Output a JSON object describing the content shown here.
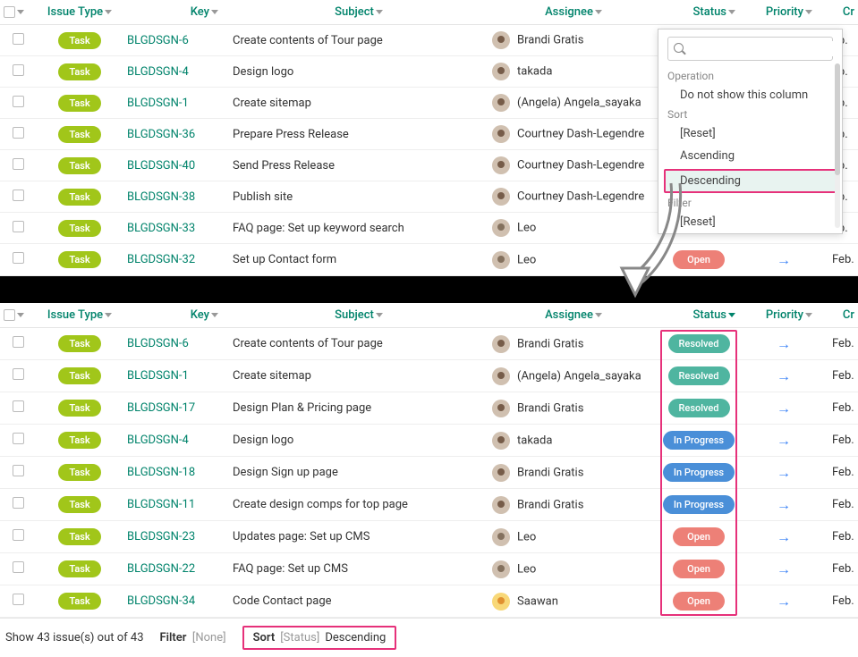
{
  "columns": {
    "checkbox": "",
    "issue_type": "Issue Type",
    "key": "Key",
    "subject": "Subject",
    "assignee": "Assignee",
    "status": "Status",
    "priority": "Priority",
    "created": "Cr"
  },
  "task_label": "Task",
  "dropdown": {
    "search_placeholder": "",
    "section_operation": "Operation",
    "op_hide": "Do not show this column",
    "section_sort": "Sort",
    "sort_reset": "[Reset]",
    "sort_asc": "Ascending",
    "sort_desc": "Descending",
    "section_filter": "Filter",
    "filter_reset": "[Reset]"
  },
  "top_rows": [
    {
      "key": "BLGDSGN-6",
      "subject": "Create contents of Tour page",
      "assignee": "Brandi Gratis",
      "status": "",
      "priority": "",
      "cr": "eb."
    },
    {
      "key": "BLGDSGN-4",
      "subject": "Design logo",
      "assignee": "takada",
      "status": "",
      "priority": "",
      "cr": "eb."
    },
    {
      "key": "BLGDSGN-1",
      "subject": "Create sitemap",
      "assignee": "(Angela) Angela_sayaka",
      "status": "",
      "priority": "",
      "cr": "eb."
    },
    {
      "key": "BLGDSGN-36",
      "subject": "Prepare Press Release",
      "assignee": "Courtney Dash-Legendre",
      "status": "",
      "priority": "",
      "cr": "eb."
    },
    {
      "key": "BLGDSGN-40",
      "subject": "Send Press Release",
      "assignee": "Courtney Dash-Legendre",
      "status": "",
      "priority": "",
      "cr": "eb."
    },
    {
      "key": "BLGDSGN-38",
      "subject": "Publish site",
      "assignee": "Courtney Dash-Legendre",
      "status": "",
      "priority": "",
      "cr": "eb."
    },
    {
      "key": "BLGDSGN-33",
      "subject": "FAQ page: Set up keyword search",
      "assignee": "Leo",
      "status": "",
      "priority": "",
      "cr": "eb."
    },
    {
      "key": "BLGDSGN-32",
      "subject": "Set up Contact form",
      "assignee": "Leo",
      "status": "Open",
      "status_cls": "open",
      "priority": "→",
      "cr": "Feb."
    }
  ],
  "bottom_rows": [
    {
      "key": "BLGDSGN-6",
      "subject": "Create contents of Tour page",
      "assignee": "Brandi Gratis",
      "status": "Resolved",
      "status_cls": "resolved",
      "priority": "→",
      "cr": "Feb."
    },
    {
      "key": "BLGDSGN-1",
      "subject": "Create sitemap",
      "assignee": "(Angela) Angela_sayaka",
      "status": "Resolved",
      "status_cls": "resolved",
      "priority": "→",
      "cr": "Feb."
    },
    {
      "key": "BLGDSGN-17",
      "subject": "Design Plan & Pricing page",
      "assignee": "Brandi Gratis",
      "status": "Resolved",
      "status_cls": "resolved",
      "priority": "→",
      "cr": "Feb."
    },
    {
      "key": "BLGDSGN-4",
      "subject": "Design logo",
      "assignee": "takada",
      "status": "In Progress",
      "status_cls": "inprogress",
      "priority": "→",
      "cr": "Feb."
    },
    {
      "key": "BLGDSGN-18",
      "subject": "Design Sign up page",
      "assignee": "Brandi Gratis",
      "status": "In Progress",
      "status_cls": "inprogress",
      "priority": "→",
      "cr": "Feb."
    },
    {
      "key": "BLGDSGN-11",
      "subject": "Create design comps for top page",
      "assignee": "Brandi Gratis",
      "status": "In Progress",
      "status_cls": "inprogress",
      "priority": "→",
      "cr": "Feb."
    },
    {
      "key": "BLGDSGN-23",
      "subject": "Updates page: Set up CMS",
      "assignee": "Leo",
      "status": "Open",
      "status_cls": "open",
      "priority": "→",
      "cr": "Feb."
    },
    {
      "key": "BLGDSGN-22",
      "subject": "FAQ page: Set up CMS",
      "assignee": "Leo",
      "status": "Open",
      "status_cls": "open",
      "priority": "→",
      "cr": "Feb."
    },
    {
      "key": "BLGDSGN-34",
      "subject": "Code Contact page",
      "assignee": "Saawan",
      "status": "Open",
      "status_cls": "open",
      "priority": "→",
      "cr": "Feb."
    }
  ],
  "footer": {
    "count": "Show 43 issue(s) out of 43",
    "filter_label": "Filter",
    "filter_value": "[None]",
    "sort_label": "Sort",
    "sort_field": "[Status]",
    "sort_dir": "Descending"
  }
}
